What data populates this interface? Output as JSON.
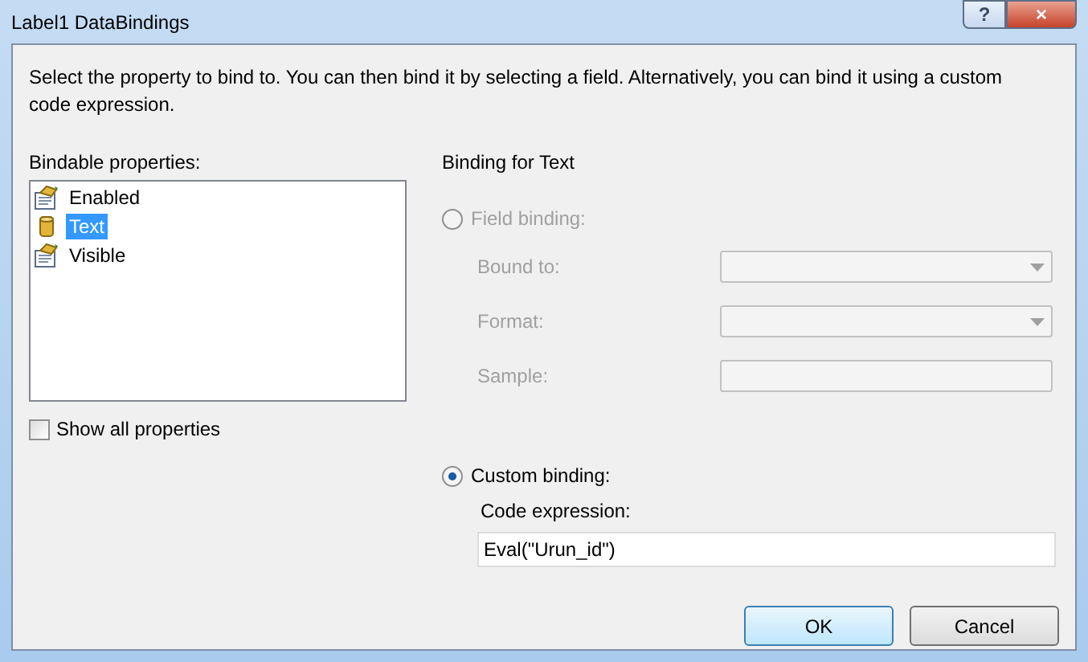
{
  "window": {
    "title": "Label1 DataBindings",
    "buttons": [
      "?",
      "×"
    ]
  },
  "description": "Select the property to bind to. You can then bind it by selecting a field. Alternatively, you can bind it using a custom code expression.",
  "bindable": {
    "label": "Bindable properties:",
    "items": [
      {
        "label": "Enabled",
        "kind": "property",
        "selected": false
      },
      {
        "label": "Text",
        "kind": "field",
        "selected": true
      },
      {
        "label": "Visible",
        "kind": "property",
        "selected": false
      }
    ],
    "show_all": {
      "label": "Show all properties",
      "checked": false
    }
  },
  "binding": {
    "title": "Binding for Text",
    "field_binding": {
      "label": "Field binding:",
      "selected": false,
      "disabled": true,
      "rows": [
        {
          "label": "Bound to:",
          "kind": "dropdown"
        },
        {
          "label": "Format:",
          "kind": "dropdown"
        },
        {
          "label": "Sample:",
          "kind": "text"
        }
      ]
    },
    "custom_binding": {
      "label": "Custom binding:",
      "selected": true,
      "expression_label": "Code expression:",
      "expression": "Eval(\"Urun_id\")"
    }
  },
  "buttons": [
    {
      "label": "OK",
      "default": true
    },
    {
      "label": "Cancel",
      "default": false
    }
  ]
}
